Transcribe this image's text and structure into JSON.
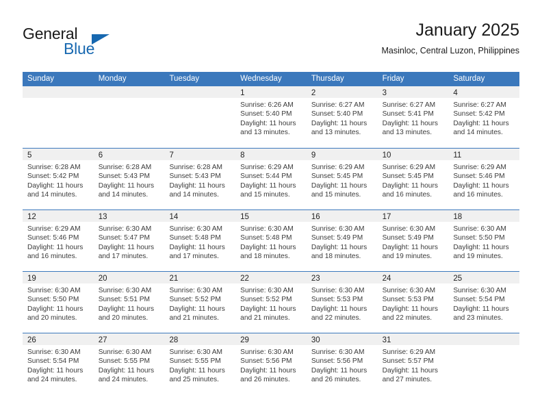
{
  "brand": {
    "word_one": "General",
    "word_two": "Blue",
    "accent_color": "#1768b0",
    "triangle_icon": "brand-triangle-icon"
  },
  "header": {
    "month_title": "January 2025",
    "location": "Masinloc, Central Luzon, Philippines"
  },
  "theme": {
    "header_blue": "#3b78bc",
    "day_band_gray": "#f0f0f0",
    "text_dark": "#222222"
  },
  "weekdays": [
    "Sunday",
    "Monday",
    "Tuesday",
    "Wednesday",
    "Thursday",
    "Friday",
    "Saturday"
  ],
  "labels": {
    "sunrise_prefix": "Sunrise:",
    "sunset_prefix": "Sunset:",
    "daylight_prefix": "Daylight:"
  },
  "weeks": [
    [
      {
        "day": "",
        "sunrise": "",
        "sunset": "",
        "daylight_a": "",
        "daylight_b": ""
      },
      {
        "day": "",
        "sunrise": "",
        "sunset": "",
        "daylight_a": "",
        "daylight_b": ""
      },
      {
        "day": "",
        "sunrise": "",
        "sunset": "",
        "daylight_a": "",
        "daylight_b": ""
      },
      {
        "day": "1",
        "sunrise": "Sunrise: 6:26 AM",
        "sunset": "Sunset: 5:40 PM",
        "daylight_a": "Daylight: 11 hours",
        "daylight_b": "and 13 minutes."
      },
      {
        "day": "2",
        "sunrise": "Sunrise: 6:27 AM",
        "sunset": "Sunset: 5:40 PM",
        "daylight_a": "Daylight: 11 hours",
        "daylight_b": "and 13 minutes."
      },
      {
        "day": "3",
        "sunrise": "Sunrise: 6:27 AM",
        "sunset": "Sunset: 5:41 PM",
        "daylight_a": "Daylight: 11 hours",
        "daylight_b": "and 13 minutes."
      },
      {
        "day": "4",
        "sunrise": "Sunrise: 6:27 AM",
        "sunset": "Sunset: 5:42 PM",
        "daylight_a": "Daylight: 11 hours",
        "daylight_b": "and 14 minutes."
      }
    ],
    [
      {
        "day": "5",
        "sunrise": "Sunrise: 6:28 AM",
        "sunset": "Sunset: 5:42 PM",
        "daylight_a": "Daylight: 11 hours",
        "daylight_b": "and 14 minutes."
      },
      {
        "day": "6",
        "sunrise": "Sunrise: 6:28 AM",
        "sunset": "Sunset: 5:43 PM",
        "daylight_a": "Daylight: 11 hours",
        "daylight_b": "and 14 minutes."
      },
      {
        "day": "7",
        "sunrise": "Sunrise: 6:28 AM",
        "sunset": "Sunset: 5:43 PM",
        "daylight_a": "Daylight: 11 hours",
        "daylight_b": "and 14 minutes."
      },
      {
        "day": "8",
        "sunrise": "Sunrise: 6:29 AM",
        "sunset": "Sunset: 5:44 PM",
        "daylight_a": "Daylight: 11 hours",
        "daylight_b": "and 15 minutes."
      },
      {
        "day": "9",
        "sunrise": "Sunrise: 6:29 AM",
        "sunset": "Sunset: 5:45 PM",
        "daylight_a": "Daylight: 11 hours",
        "daylight_b": "and 15 minutes."
      },
      {
        "day": "10",
        "sunrise": "Sunrise: 6:29 AM",
        "sunset": "Sunset: 5:45 PM",
        "daylight_a": "Daylight: 11 hours",
        "daylight_b": "and 16 minutes."
      },
      {
        "day": "11",
        "sunrise": "Sunrise: 6:29 AM",
        "sunset": "Sunset: 5:46 PM",
        "daylight_a": "Daylight: 11 hours",
        "daylight_b": "and 16 minutes."
      }
    ],
    [
      {
        "day": "12",
        "sunrise": "Sunrise: 6:29 AM",
        "sunset": "Sunset: 5:46 PM",
        "daylight_a": "Daylight: 11 hours",
        "daylight_b": "and 16 minutes."
      },
      {
        "day": "13",
        "sunrise": "Sunrise: 6:30 AM",
        "sunset": "Sunset: 5:47 PM",
        "daylight_a": "Daylight: 11 hours",
        "daylight_b": "and 17 minutes."
      },
      {
        "day": "14",
        "sunrise": "Sunrise: 6:30 AM",
        "sunset": "Sunset: 5:48 PM",
        "daylight_a": "Daylight: 11 hours",
        "daylight_b": "and 17 minutes."
      },
      {
        "day": "15",
        "sunrise": "Sunrise: 6:30 AM",
        "sunset": "Sunset: 5:48 PM",
        "daylight_a": "Daylight: 11 hours",
        "daylight_b": "and 18 minutes."
      },
      {
        "day": "16",
        "sunrise": "Sunrise: 6:30 AM",
        "sunset": "Sunset: 5:49 PM",
        "daylight_a": "Daylight: 11 hours",
        "daylight_b": "and 18 minutes."
      },
      {
        "day": "17",
        "sunrise": "Sunrise: 6:30 AM",
        "sunset": "Sunset: 5:49 PM",
        "daylight_a": "Daylight: 11 hours",
        "daylight_b": "and 19 minutes."
      },
      {
        "day": "18",
        "sunrise": "Sunrise: 6:30 AM",
        "sunset": "Sunset: 5:50 PM",
        "daylight_a": "Daylight: 11 hours",
        "daylight_b": "and 19 minutes."
      }
    ],
    [
      {
        "day": "19",
        "sunrise": "Sunrise: 6:30 AM",
        "sunset": "Sunset: 5:50 PM",
        "daylight_a": "Daylight: 11 hours",
        "daylight_b": "and 20 minutes."
      },
      {
        "day": "20",
        "sunrise": "Sunrise: 6:30 AM",
        "sunset": "Sunset: 5:51 PM",
        "daylight_a": "Daylight: 11 hours",
        "daylight_b": "and 20 minutes."
      },
      {
        "day": "21",
        "sunrise": "Sunrise: 6:30 AM",
        "sunset": "Sunset: 5:52 PM",
        "daylight_a": "Daylight: 11 hours",
        "daylight_b": "and 21 minutes."
      },
      {
        "day": "22",
        "sunrise": "Sunrise: 6:30 AM",
        "sunset": "Sunset: 5:52 PM",
        "daylight_a": "Daylight: 11 hours",
        "daylight_b": "and 21 minutes."
      },
      {
        "day": "23",
        "sunrise": "Sunrise: 6:30 AM",
        "sunset": "Sunset: 5:53 PM",
        "daylight_a": "Daylight: 11 hours",
        "daylight_b": "and 22 minutes."
      },
      {
        "day": "24",
        "sunrise": "Sunrise: 6:30 AM",
        "sunset": "Sunset: 5:53 PM",
        "daylight_a": "Daylight: 11 hours",
        "daylight_b": "and 22 minutes."
      },
      {
        "day": "25",
        "sunrise": "Sunrise: 6:30 AM",
        "sunset": "Sunset: 5:54 PM",
        "daylight_a": "Daylight: 11 hours",
        "daylight_b": "and 23 minutes."
      }
    ],
    [
      {
        "day": "26",
        "sunrise": "Sunrise: 6:30 AM",
        "sunset": "Sunset: 5:54 PM",
        "daylight_a": "Daylight: 11 hours",
        "daylight_b": "and 24 minutes."
      },
      {
        "day": "27",
        "sunrise": "Sunrise: 6:30 AM",
        "sunset": "Sunset: 5:55 PM",
        "daylight_a": "Daylight: 11 hours",
        "daylight_b": "and 24 minutes."
      },
      {
        "day": "28",
        "sunrise": "Sunrise: 6:30 AM",
        "sunset": "Sunset: 5:55 PM",
        "daylight_a": "Daylight: 11 hours",
        "daylight_b": "and 25 minutes."
      },
      {
        "day": "29",
        "sunrise": "Sunrise: 6:30 AM",
        "sunset": "Sunset: 5:56 PM",
        "daylight_a": "Daylight: 11 hours",
        "daylight_b": "and 26 minutes."
      },
      {
        "day": "30",
        "sunrise": "Sunrise: 6:30 AM",
        "sunset": "Sunset: 5:56 PM",
        "daylight_a": "Daylight: 11 hours",
        "daylight_b": "and 26 minutes."
      },
      {
        "day": "31",
        "sunrise": "Sunrise: 6:29 AM",
        "sunset": "Sunset: 5:57 PM",
        "daylight_a": "Daylight: 11 hours",
        "daylight_b": "and 27 minutes."
      },
      {
        "day": "",
        "sunrise": "",
        "sunset": "",
        "daylight_a": "",
        "daylight_b": ""
      }
    ]
  ]
}
